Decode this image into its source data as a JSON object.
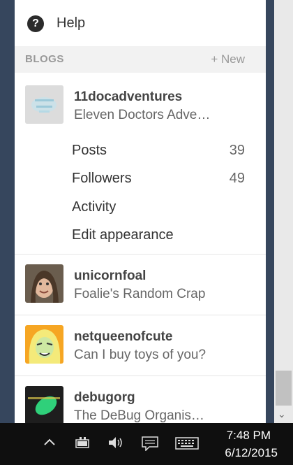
{
  "menu": {
    "help_label": "Help",
    "help_icon": "?"
  },
  "blogs": {
    "section_title": "BLOGS",
    "new_label": "+ New",
    "primary": {
      "name": "11docadventures",
      "subtitle": "Eleven Doctors Adve…",
      "items": [
        {
          "label": "Posts",
          "count": "39"
        },
        {
          "label": "Followers",
          "count": "49"
        },
        {
          "label": "Activity",
          "count": ""
        },
        {
          "label": "Edit appearance",
          "count": ""
        }
      ]
    },
    "others": [
      {
        "name": "unicornfoal",
        "subtitle": "Foalie's Random Crap"
      },
      {
        "name": "netqueenofcute",
        "subtitle": "Can I buy toys of you?"
      },
      {
        "name": "debugorg",
        "subtitle": "The DeBug Organis…"
      }
    ]
  },
  "taskbar": {
    "time": "7:48 PM",
    "date": "6/12/2015",
    "icons": [
      "chevron-up-icon",
      "battery-icon",
      "volume-icon",
      "action-center-icon",
      "keyboard-icon"
    ]
  },
  "colors": {
    "background": "#36465d",
    "panel": "#ffffff",
    "section_header": "#f2f2f2",
    "taskbar": "#0f0f0f"
  }
}
